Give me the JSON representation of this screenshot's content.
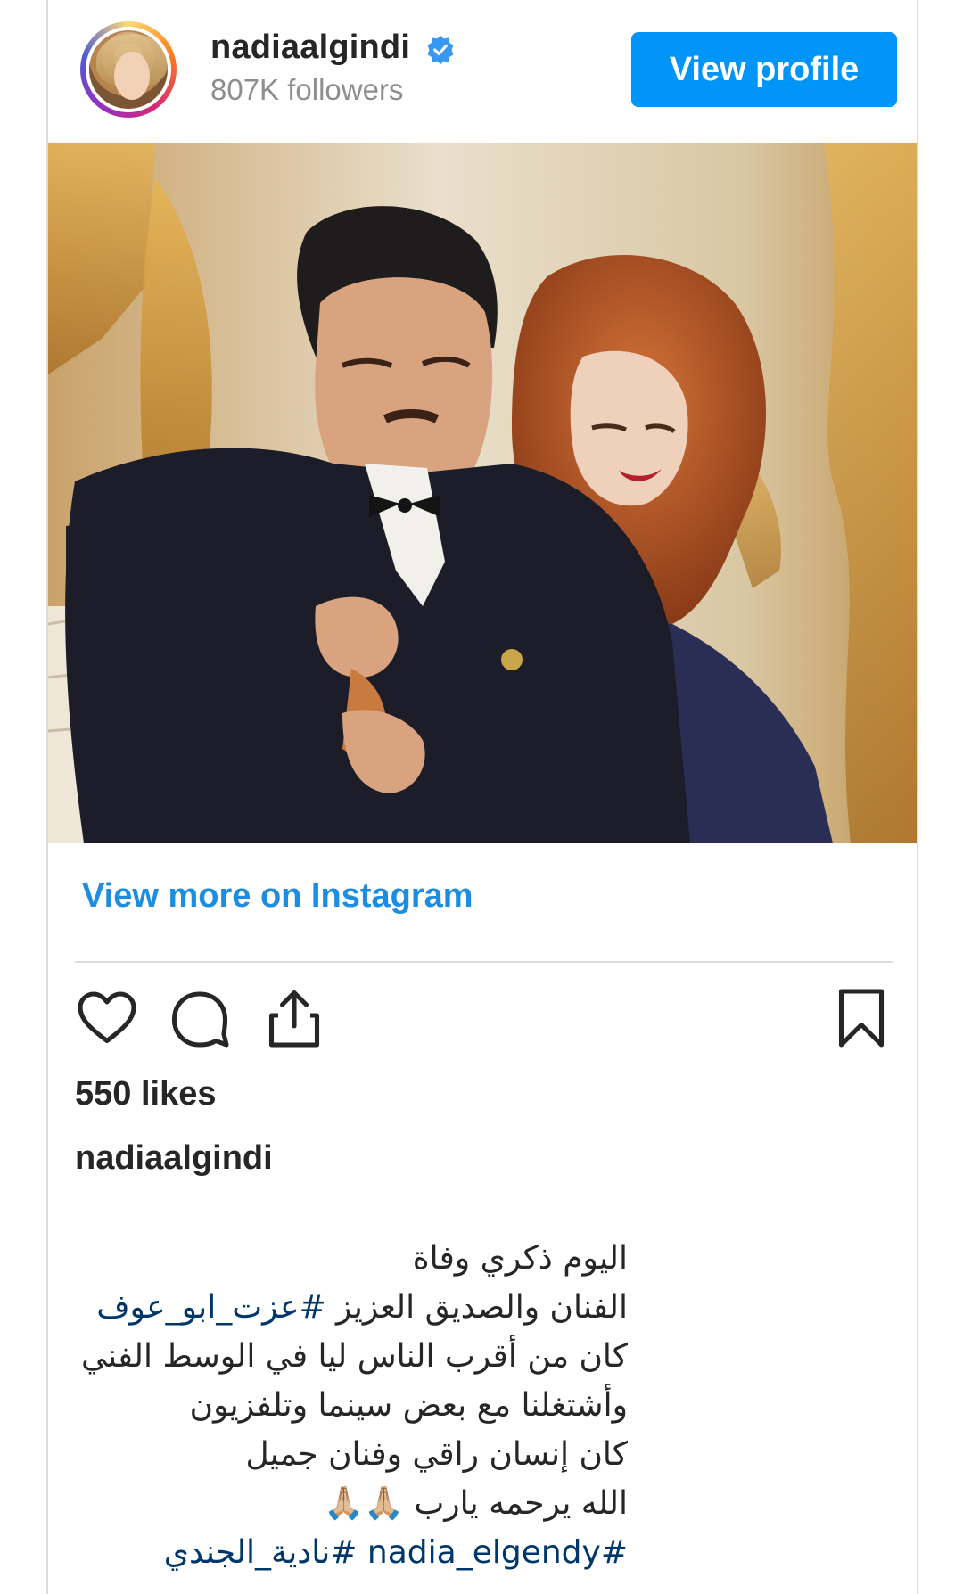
{
  "header": {
    "username": "nadiaalgindi",
    "followers": "807K followers",
    "view_profile_label": "View profile",
    "verified_icon": "verified-badge-icon",
    "colors": {
      "button": "#0095f6",
      "verified": "#3897f0"
    }
  },
  "post": {
    "view_more_label": "View more on Instagram",
    "likes": "550 likes",
    "caption_user": "nadiaalgindi",
    "caption": {
      "line1": "اليوم ذكري وفاة",
      "line2_text": "الفنان والصديق العزيز ",
      "line2_tag": "#عزت_ابو_عوف",
      "line3": "كان من أقرب الناس ليا في الوسط الفني",
      "line4": "وأشتغلنا مع بعض سينما وتلفزيون",
      "line5": "كان إنسان راقي وفنان جميل",
      "line6": "الله يرحمه يارب 🙏🏼🙏🏼",
      "line7_tag1": "#nadia_elgendy",
      "line7_tag2": "#نادية_الجندي"
    }
  },
  "actions": {
    "icons": [
      "heart-icon",
      "comment-icon",
      "share-icon",
      "bookmark-icon"
    ]
  }
}
